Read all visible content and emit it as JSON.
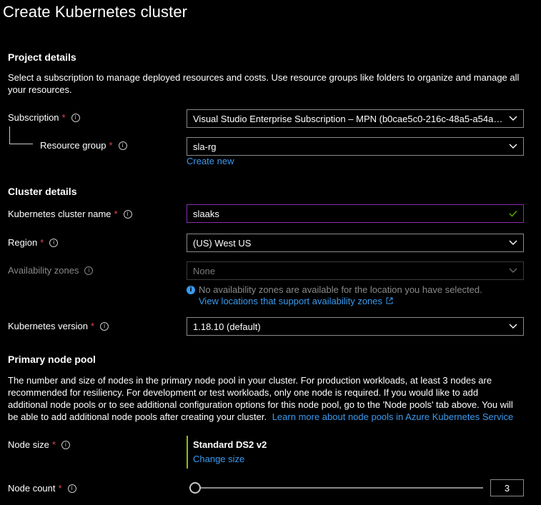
{
  "page": {
    "title": "Create Kubernetes cluster"
  },
  "project": {
    "heading": "Project details",
    "description": "Select a subscription to manage deployed resources and costs. Use resource groups like folders to organize and manage all your resources.",
    "subscription_label": "Subscription",
    "subscription_value": "Visual Studio Enterprise Subscription – MPN (b0cae5c0-216c-48a5-a54a-...",
    "resource_group_label": "Resource group",
    "resource_group_value": "sla-rg",
    "create_new": "Create new"
  },
  "cluster": {
    "heading": "Cluster details",
    "name_label": "Kubernetes cluster name",
    "name_value": "slaaks",
    "region_label": "Region",
    "region_value": "(US) West US",
    "zones_label": "Availability zones",
    "zones_value": "None",
    "zones_info": "No availability zones are available for the location you have selected.",
    "zones_link": "View locations that support availability zones",
    "version_label": "Kubernetes version",
    "version_value": "1.18.10 (default)"
  },
  "nodepool": {
    "heading": "Primary node pool",
    "description": "The number and size of nodes in the primary node pool in your cluster. For production workloads, at least 3 nodes are recommended for resiliency. For development or test workloads, only one node is required. If you would like to add additional node pools or to see additional configuration options for this node pool, go to the 'Node pools' tab above. You will be able to add additional node pools after creating your cluster.",
    "learn_more": "Learn more about node pools in Azure Kubernetes Service",
    "size_label": "Node size",
    "size_value": "Standard DS2 v2",
    "change_size": "Change size",
    "count_label": "Node count",
    "count_value": "3",
    "count_slider_fraction": 0.0
  },
  "common": {
    "required_mark": "*",
    "info_glyph": "i"
  },
  "colors": {
    "accent_link": "#3a9bf0",
    "required": "#e0484e",
    "valid_check": "#57a300",
    "focus_border": "#8a2bb0",
    "node_size_bar": "#8cbd18"
  },
  "icons": [
    "info-icon",
    "chevron-down-icon",
    "checkmark-icon",
    "external-link-icon",
    "info-filled-icon"
  ]
}
